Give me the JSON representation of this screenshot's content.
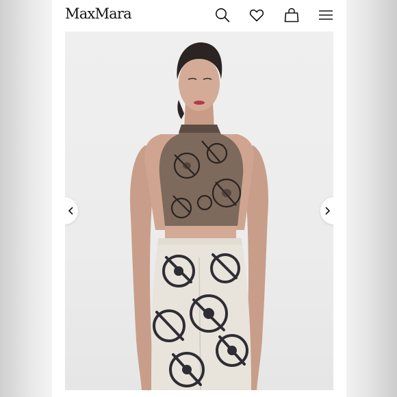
{
  "brand": {
    "logo_text": "MaxMara"
  },
  "header": {
    "icons": [
      "search-icon",
      "heart-icon",
      "shopping-bag-icon",
      "menu-icon"
    ]
  },
  "gallery": {
    "image_description_icon": "product-photo",
    "prev_icon": "chevron-left-icon",
    "next_icon": "chevron-right-icon"
  },
  "colors": {
    "page_background": "#ffffff",
    "text": "#111111",
    "photo_background": "#ececec",
    "top_print": "#7d6a5c",
    "pants_base": "#e8e4dc",
    "pants_print": "#2e2d33"
  }
}
